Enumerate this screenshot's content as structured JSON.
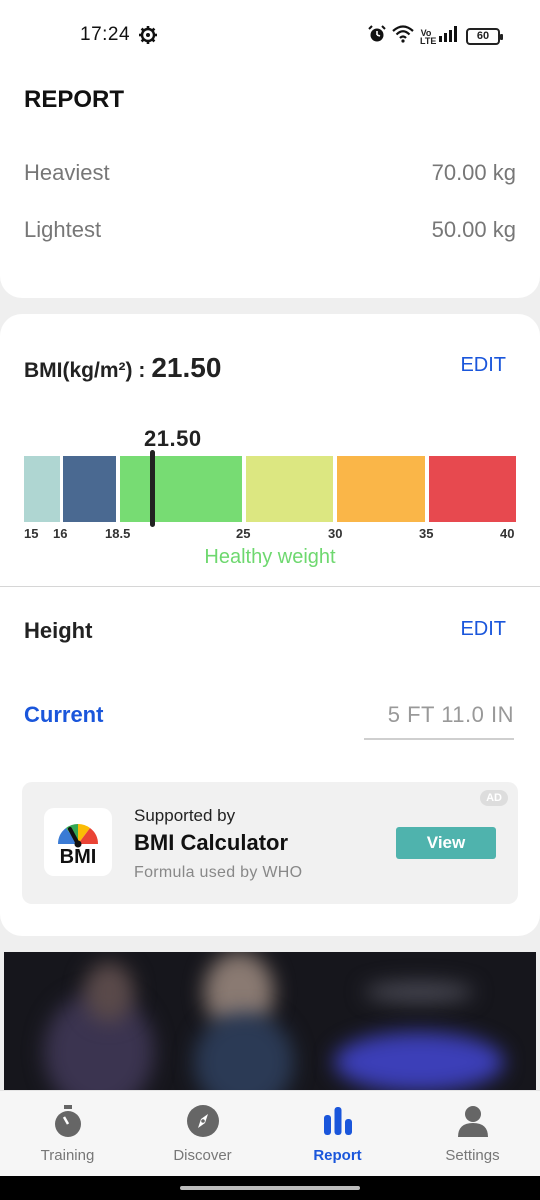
{
  "status_bar": {
    "time": "17:24",
    "battery": "60",
    "network": "Vo LTE"
  },
  "report": {
    "title": "REPORT",
    "rows": [
      {
        "label": "Heaviest",
        "value": "70.00 kg"
      },
      {
        "label": "Lightest",
        "value": "50.00 kg"
      }
    ]
  },
  "bmi": {
    "label": "BMI(kg/m²) :",
    "value": "21.50",
    "marker_value": "21.50",
    "edit_label": "EDIT",
    "status": "Healthy weight",
    "scale_ticks": [
      "15",
      "16",
      "18.5",
      "25",
      "30",
      "35",
      "40"
    ],
    "segment_colors": [
      "#afd6d2",
      "#4a6991",
      "#77dc73",
      "#dce781",
      "#fab648",
      "#e7494f"
    ]
  },
  "height": {
    "title": "Height",
    "edit_label": "EDIT",
    "current_label": "Current",
    "current_value": "5 FT 11.0 IN"
  },
  "ad": {
    "badge": "AD",
    "logo_text": "BMI",
    "supported_by": "Supported by",
    "app_name": "BMI Calculator",
    "tagline": "Formula used by WHO",
    "button": "View"
  },
  "bottom_nav": [
    {
      "label": "Training",
      "icon": "stopwatch-icon"
    },
    {
      "label": "Discover",
      "icon": "compass-icon"
    },
    {
      "label": "Report",
      "icon": "bar-chart-icon",
      "active": true
    },
    {
      "label": "Settings",
      "icon": "person-icon"
    }
  ],
  "colors": {
    "accent": "#1a56db",
    "healthy": "#6ed86f",
    "ad_button": "#4fb3ad"
  }
}
